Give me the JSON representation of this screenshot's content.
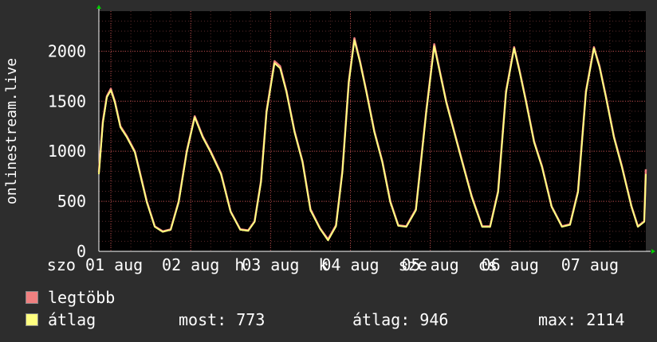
{
  "chart_data": {
    "type": "line",
    "ylabel": "onlinestream.live",
    "ylim": [
      0,
      2400
    ],
    "yticks": [
      0,
      500,
      1000,
      1500,
      2000
    ],
    "grid": true,
    "x_labels": [
      "szo 01 aug",
      "vas 02 aug",
      "hét 03 aug",
      "kedd 04 aug",
      "sze 05 aug",
      "csü 06 aug",
      "pén 07 aug"
    ],
    "x_ticks_visible": [
      "szo 01 aug",
      "02 aug",
      "03 aug",
      "04 aug",
      "05 aug",
      "06 aug",
      "07 aug"
    ],
    "x_overlap_fragments": [
      "h",
      "k",
      "sze",
      "cs"
    ],
    "x_start_offset_days": -0.15,
    "x_end_offset_days": 6.7,
    "series": [
      {
        "name": "legtöbb",
        "color": "#f08080",
        "points_days": [
          [
            -0.15,
            790
          ],
          [
            -0.1,
            1300
          ],
          [
            -0.05,
            1550
          ],
          [
            0.0,
            1625
          ],
          [
            0.05,
            1500
          ],
          [
            0.12,
            1250
          ],
          [
            0.2,
            1150
          ],
          [
            0.3,
            1000
          ],
          [
            0.45,
            500
          ],
          [
            0.55,
            250
          ],
          [
            0.65,
            200
          ],
          [
            0.75,
            220
          ],
          [
            0.85,
            500
          ],
          [
            0.95,
            1000
          ],
          [
            1.05,
            1350
          ],
          [
            1.15,
            1150
          ],
          [
            1.25,
            1000
          ],
          [
            1.38,
            780
          ],
          [
            1.5,
            400
          ],
          [
            1.62,
            220
          ],
          [
            1.72,
            210
          ],
          [
            1.8,
            300
          ],
          [
            1.88,
            700
          ],
          [
            1.95,
            1400
          ],
          [
            2.05,
            1900
          ],
          [
            2.12,
            1850
          ],
          [
            2.2,
            1600
          ],
          [
            2.3,
            1200
          ],
          [
            2.4,
            900
          ],
          [
            2.5,
            420
          ],
          [
            2.62,
            230
          ],
          [
            2.72,
            120
          ],
          [
            2.82,
            260
          ],
          [
            2.9,
            800
          ],
          [
            2.98,
            1700
          ],
          [
            3.05,
            2130
          ],
          [
            3.12,
            1900
          ],
          [
            3.2,
            1600
          ],
          [
            3.3,
            1200
          ],
          [
            3.4,
            900
          ],
          [
            3.5,
            500
          ],
          [
            3.6,
            260
          ],
          [
            3.7,
            250
          ],
          [
            3.82,
            420
          ],
          [
            3.95,
            1400
          ],
          [
            4.05,
            2070
          ],
          [
            4.12,
            1800
          ],
          [
            4.2,
            1500
          ],
          [
            4.3,
            1200
          ],
          [
            4.4,
            900
          ],
          [
            4.52,
            550
          ],
          [
            4.65,
            250
          ],
          [
            4.75,
            250
          ],
          [
            4.85,
            600
          ],
          [
            4.95,
            1600
          ],
          [
            5.05,
            2040
          ],
          [
            5.12,
            1800
          ],
          [
            5.2,
            1500
          ],
          [
            5.3,
            1100
          ],
          [
            5.4,
            850
          ],
          [
            5.52,
            450
          ],
          [
            5.65,
            250
          ],
          [
            5.75,
            270
          ],
          [
            5.85,
            600
          ],
          [
            5.95,
            1600
          ],
          [
            6.05,
            2040
          ],
          [
            6.12,
            1850
          ],
          [
            6.2,
            1550
          ],
          [
            6.3,
            1150
          ],
          [
            6.4,
            850
          ],
          [
            6.52,
            450
          ],
          [
            6.6,
            250
          ],
          [
            6.68,
            300
          ],
          [
            6.7,
            820
          ]
        ]
      },
      {
        "name": "átlag",
        "color": "#ffff80",
        "points_days": [
          [
            -0.15,
            770
          ],
          [
            -0.1,
            1280
          ],
          [
            -0.05,
            1540
          ],
          [
            0.0,
            1610
          ],
          [
            0.05,
            1490
          ],
          [
            0.12,
            1240
          ],
          [
            0.2,
            1140
          ],
          [
            0.3,
            990
          ],
          [
            0.45,
            490
          ],
          [
            0.55,
            245
          ],
          [
            0.65,
            195
          ],
          [
            0.75,
            215
          ],
          [
            0.85,
            490
          ],
          [
            0.95,
            990
          ],
          [
            1.05,
            1340
          ],
          [
            1.15,
            1140
          ],
          [
            1.25,
            990
          ],
          [
            1.38,
            770
          ],
          [
            1.5,
            395
          ],
          [
            1.62,
            215
          ],
          [
            1.72,
            205
          ],
          [
            1.8,
            295
          ],
          [
            1.88,
            690
          ],
          [
            1.95,
            1390
          ],
          [
            2.05,
            1880
          ],
          [
            2.12,
            1830
          ],
          [
            2.2,
            1590
          ],
          [
            2.3,
            1190
          ],
          [
            2.4,
            890
          ],
          [
            2.5,
            410
          ],
          [
            2.62,
            225
          ],
          [
            2.72,
            110
          ],
          [
            2.82,
            250
          ],
          [
            2.9,
            790
          ],
          [
            2.98,
            1690
          ],
          [
            3.05,
            2110
          ],
          [
            3.12,
            1890
          ],
          [
            3.2,
            1590
          ],
          [
            3.3,
            1190
          ],
          [
            3.4,
            890
          ],
          [
            3.5,
            490
          ],
          [
            3.6,
            255
          ],
          [
            3.7,
            245
          ],
          [
            3.82,
            410
          ],
          [
            3.95,
            1390
          ],
          [
            4.05,
            2050
          ],
          [
            4.12,
            1790
          ],
          [
            4.2,
            1490
          ],
          [
            4.3,
            1190
          ],
          [
            4.4,
            890
          ],
          [
            4.52,
            540
          ],
          [
            4.65,
            245
          ],
          [
            4.75,
            245
          ],
          [
            4.85,
            590
          ],
          [
            4.95,
            1590
          ],
          [
            5.05,
            2030
          ],
          [
            5.12,
            1790
          ],
          [
            5.2,
            1490
          ],
          [
            5.3,
            1090
          ],
          [
            5.4,
            840
          ],
          [
            5.52,
            445
          ],
          [
            5.65,
            245
          ],
          [
            5.75,
            265
          ],
          [
            5.85,
            590
          ],
          [
            5.95,
            1590
          ],
          [
            6.05,
            2030
          ],
          [
            6.12,
            1840
          ],
          [
            6.2,
            1540
          ],
          [
            6.3,
            1140
          ],
          [
            6.4,
            840
          ],
          [
            6.52,
            445
          ],
          [
            6.6,
            245
          ],
          [
            6.68,
            295
          ],
          [
            6.7,
            773
          ]
        ]
      }
    ]
  },
  "legend": {
    "max_label": "legtöbb",
    "avg_label": "átlag",
    "max_color": "#f08080",
    "avg_color": "#ffff80"
  },
  "stats": {
    "now": "most: 773",
    "avg": "átlag: 946",
    "max": "max: 2114"
  }
}
